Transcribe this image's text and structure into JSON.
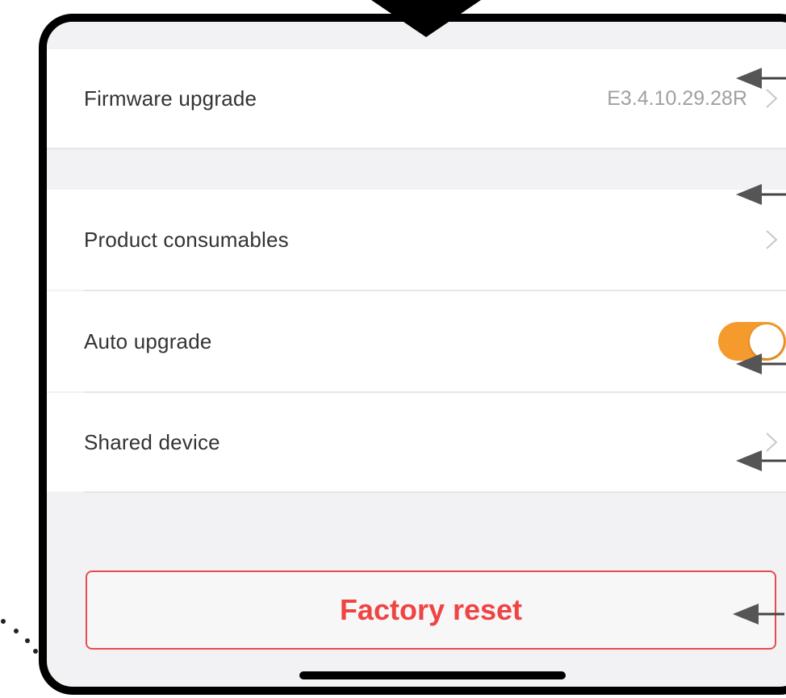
{
  "settings": {
    "firmware": {
      "label": "Firmware upgrade",
      "value": "E3.4.10.29.28R"
    },
    "consumables": {
      "label": "Product consumables"
    },
    "auto_upgrade": {
      "label": "Auto upgrade",
      "enabled": true
    },
    "shared_device": {
      "label": "Shared device"
    }
  },
  "actions": {
    "factory_reset_label": "Factory reset"
  },
  "colors": {
    "accent_toggle": "#f59a2c",
    "danger": "#ef4444",
    "background": "#f2f2f4"
  },
  "icons": {
    "chevron": "chevron-right-icon",
    "callout_arrow": "arrow-left-icon",
    "callout_pointer": "triangle-down-icon"
  }
}
